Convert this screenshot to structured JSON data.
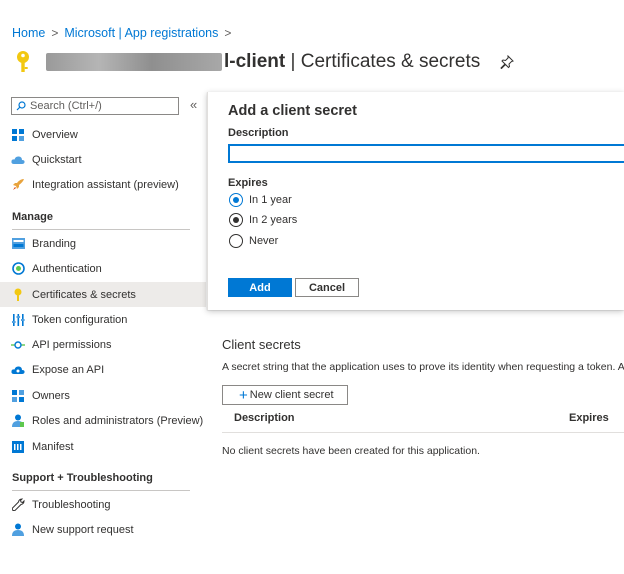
{
  "breadcrumb": {
    "items": [
      "Home",
      "Microsoft | App registrations"
    ],
    "separator": ">"
  },
  "header": {
    "title_visible_suffix": "l-client",
    "title_rest": " | Certificates & secrets",
    "icon": "key-icon",
    "pin_icon": "pin-icon"
  },
  "sidebar": {
    "search_placeholder": "Search (Ctrl+/)",
    "collapse_glyph": "«",
    "top_items": [
      {
        "label": "Overview",
        "icon": "overview-grid-icon"
      },
      {
        "label": "Quickstart",
        "icon": "cloud-icon"
      },
      {
        "label": "Integration assistant (preview)",
        "icon": "rocket-icon"
      }
    ],
    "manage_heading": "Manage",
    "manage_items": [
      {
        "label": "Branding",
        "icon": "branding-icon"
      },
      {
        "label": "Authentication",
        "icon": "authentication-icon"
      },
      {
        "label": "Certificates & secrets",
        "icon": "key-icon",
        "active": true
      },
      {
        "label": "Token configuration",
        "icon": "token-config-icon"
      },
      {
        "label": "API permissions",
        "icon": "api-permissions-icon"
      },
      {
        "label": "Expose an API",
        "icon": "cloud-api-icon"
      },
      {
        "label": "Owners",
        "icon": "owners-icon"
      },
      {
        "label": "Roles and administrators (Preview)",
        "icon": "roles-icon"
      },
      {
        "label": "Manifest",
        "icon": "manifest-icon"
      }
    ],
    "support_heading": "Support + Troubleshooting",
    "support_items": [
      {
        "label": "Troubleshooting",
        "icon": "wrench-icon"
      },
      {
        "label": "New support request",
        "icon": "support-person-icon"
      }
    ]
  },
  "panel": {
    "title": "Add a client secret",
    "description_label": "Description",
    "description_value": "",
    "expires_label": "Expires",
    "options": [
      {
        "label": "In 1 year",
        "state": "selected-focus"
      },
      {
        "label": "In 2 years",
        "state": "selected"
      },
      {
        "label": "Never",
        "state": "unselected"
      }
    ],
    "add_label": "Add",
    "cancel_label": "Cancel"
  },
  "main": {
    "section_title": "Client secrets",
    "description": "A secret string that the application uses to prove its identity when requesting a token. Al",
    "new_button_plus": "+",
    "new_button_label": "New client secret",
    "columns": [
      "Description",
      "Expires"
    ],
    "empty_message": "No client secrets have been created for this application."
  },
  "colors": {
    "accent": "#0078d4",
    "active_nav": "#edebe9",
    "key_yellow": "#f2c811"
  }
}
